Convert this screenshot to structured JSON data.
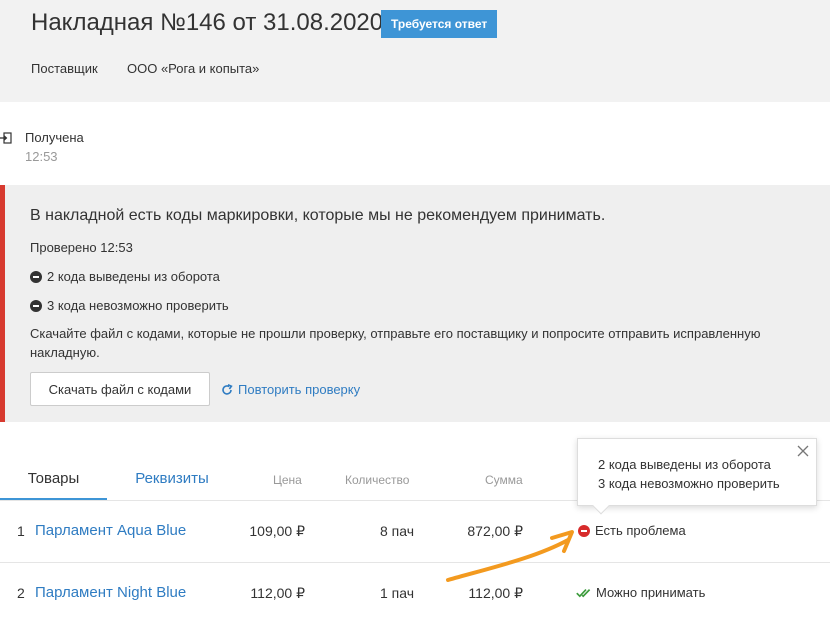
{
  "header": {
    "title": "Накладная №146 от 31.08.2020",
    "badge": "Требуется ответ",
    "supplier_label": "Поставщик",
    "supplier_value": "ООО «Рога и копыта»"
  },
  "status": {
    "icon": "sign-in-icon",
    "text": "Получена",
    "time": "12:53"
  },
  "alert": {
    "title": "В накладной есть коды маркировки, которые мы не рекомендуем принимать.",
    "checked": "Проверено 12:53",
    "issues": [
      "2 кода выведены из оборота",
      "3 кода невозможно проверить"
    ],
    "description": "Скачайте файл с кодами, которые не прошли проверку, отправьте его поставщику и попросите отправить исправленную накладную.",
    "download_button": "Скачать файл с кодами",
    "retry_link": "Повторить проверку",
    "accent_color": "#d73a2f"
  },
  "tabs": [
    "Товары",
    "Реквизиты"
  ],
  "columns": [
    "Цена",
    "Количество",
    "Сумма"
  ],
  "rows": [
    {
      "index": "1",
      "name": "Парламент Aqua Blue",
      "price": "109,00 ₽",
      "quantity": "8 пач",
      "sum": "872,00 ₽",
      "status": "Есть проблема",
      "status_icon": "error-icon"
    },
    {
      "index": "2",
      "name": "Парламент Night Blue",
      "price": "112,00 ₽",
      "quantity": "1 пач",
      "sum": "112,00 ₽",
      "status": "Можно принимать",
      "status_icon": "double-check-icon"
    }
  ],
  "tooltip": {
    "lines": [
      "2 кода выведены из оборота",
      "3 кода невозможно проверить"
    ],
    "close_icon": "close-icon"
  },
  "colors": {
    "link": "#2f7cc2",
    "badge": "#3e95d6",
    "error": "#d72b2b",
    "success": "#3c9b3c",
    "annotation_arrow": "#f39a1f"
  }
}
